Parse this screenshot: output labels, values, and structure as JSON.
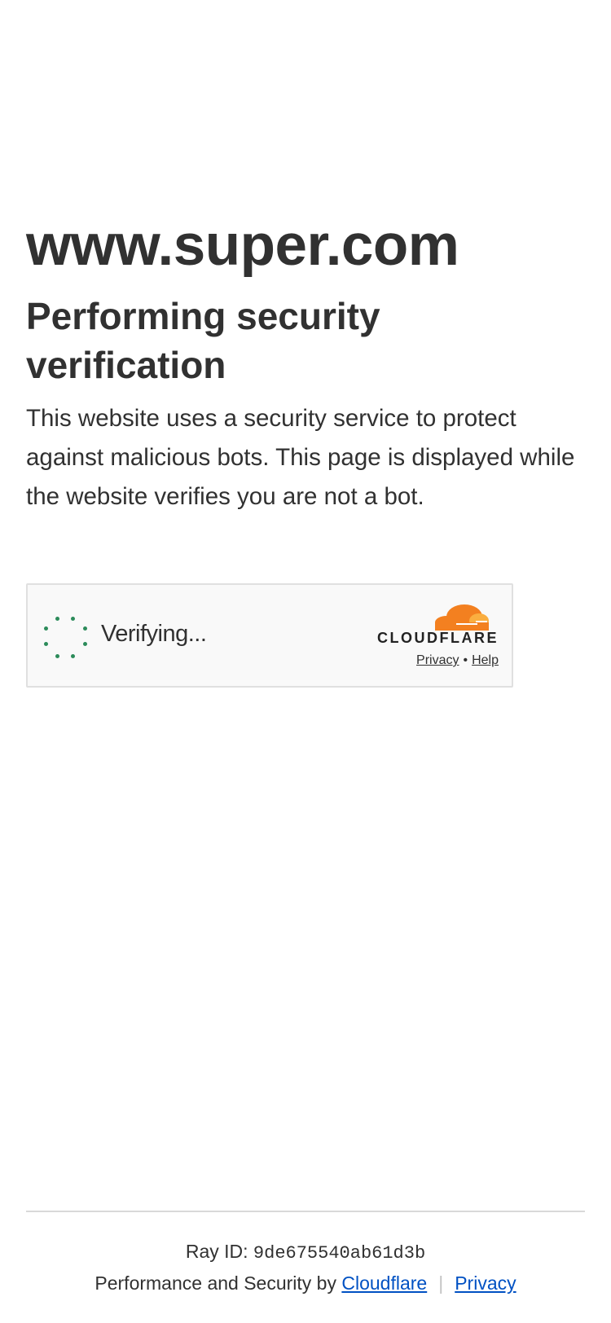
{
  "site_name": "www.super.com",
  "title": "Performing security verification",
  "description": "This website uses a security service to protect against malicious bots. This page is displayed while the website verifies you are not a bot.",
  "widget": {
    "status_label": "Verifying...",
    "brand_name": "CLOUDFLARE",
    "privacy_link": "Privacy",
    "separator": "•",
    "help_link": "Help",
    "spinner_color": "#2c8b5a",
    "brand_color": "#f38020"
  },
  "footer": {
    "ray_label": "Ray ID:",
    "ray_id": "9de675540ab61d3b",
    "perf_text": "Performance and Security by",
    "cloudflare_link": "Cloudflare",
    "divider": "|",
    "privacy_link": "Privacy",
    "link_color": "#0051c3"
  }
}
